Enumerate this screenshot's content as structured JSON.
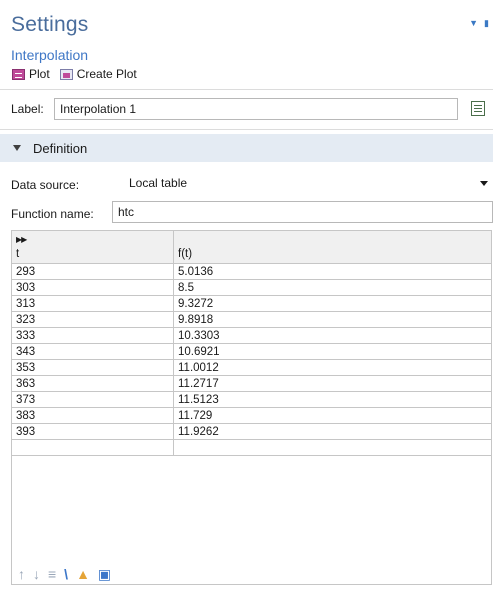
{
  "header": {
    "title": "Settings",
    "subtitle": "Interpolation"
  },
  "toolbar": {
    "plot_label": "Plot",
    "create_plot_label": "Create Plot"
  },
  "label_field": {
    "label": "Label:",
    "value": "Interpolation 1"
  },
  "section": {
    "title": "Definition"
  },
  "data_source": {
    "label": "Data source:",
    "value": "Local table"
  },
  "function_name": {
    "label": "Function name:",
    "value": "htc"
  },
  "table": {
    "columns": [
      "t",
      "f(t)"
    ],
    "rows": [
      [
        "293",
        "5.0136"
      ],
      [
        "303",
        "8.5"
      ],
      [
        "313",
        "9.3272"
      ],
      [
        "323",
        "9.8918"
      ],
      [
        "333",
        "10.3303"
      ],
      [
        "343",
        "10.6921"
      ],
      [
        "353",
        "11.0012"
      ],
      [
        "363",
        "11.2717"
      ],
      [
        "373",
        "11.5123"
      ],
      [
        "383",
        "11.729"
      ],
      [
        "393",
        "11.9262"
      ],
      [
        "",
        ""
      ]
    ]
  },
  "bottom_toolbar": {
    "icons": [
      "move-up-icon",
      "move-down-icon",
      "delete-rows-icon",
      "clear-table-icon",
      "load-from-file-icon",
      "save-to-file-icon"
    ]
  },
  "colors": {
    "title": "#4a6d9c",
    "subtitle": "#3f77c6",
    "section_bg": "#e4ebf3",
    "accent": "#3d77c9"
  }
}
